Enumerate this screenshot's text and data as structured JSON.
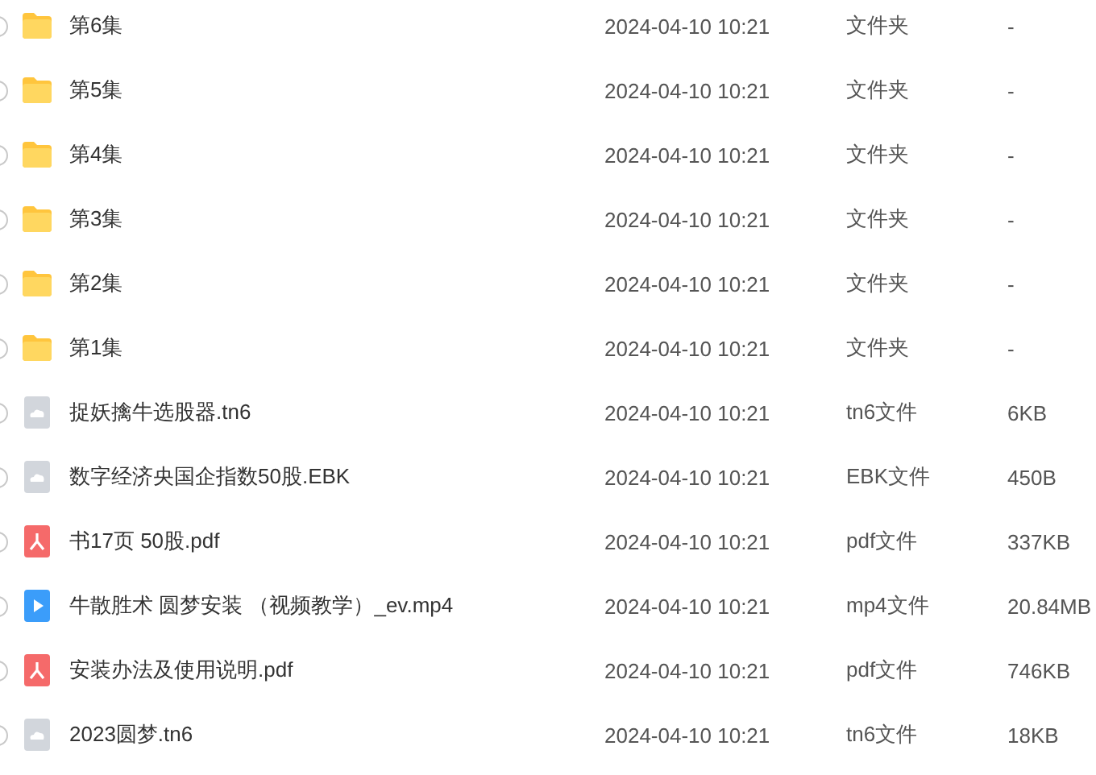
{
  "files": [
    {
      "kind": "folder",
      "checked": false,
      "name": "第6集",
      "modified": "2024-04-10 10:21",
      "type": "文件夹",
      "size": "-"
    },
    {
      "kind": "folder",
      "checked": false,
      "name": "第5集",
      "modified": "2024-04-10 10:21",
      "type": "文件夹",
      "size": "-"
    },
    {
      "kind": "folder",
      "checked": false,
      "name": "第4集",
      "modified": "2024-04-10 10:21",
      "type": "文件夹",
      "size": "-"
    },
    {
      "kind": "folder",
      "checked": false,
      "name": "第3集",
      "modified": "2024-04-10 10:21",
      "type": "文件夹",
      "size": "-"
    },
    {
      "kind": "folder",
      "checked": false,
      "name": "第2集",
      "modified": "2024-04-10 10:21",
      "type": "文件夹",
      "size": "-"
    },
    {
      "kind": "folder",
      "checked": false,
      "name": "第1集",
      "modified": "2024-04-10 10:21",
      "type": "文件夹",
      "size": "-"
    },
    {
      "kind": "cloud",
      "checked": false,
      "name": "捉妖擒牛选股器.tn6",
      "modified": "2024-04-10 10:21",
      "type": "tn6文件",
      "size": "6KB"
    },
    {
      "kind": "cloud",
      "checked": false,
      "name": "数字经济央国企指数50股.EBK",
      "modified": "2024-04-10 10:21",
      "type": "EBK文件",
      "size": "450B"
    },
    {
      "kind": "pdf",
      "checked": false,
      "name": "书17页 50股.pdf",
      "modified": "2024-04-10 10:21",
      "type": "pdf文件",
      "size": "337KB"
    },
    {
      "kind": "video",
      "checked": false,
      "name": "牛散胜术 圆梦安装 （视频教学）_ev.mp4",
      "modified": "2024-04-10 10:21",
      "type": "mp4文件",
      "size": "20.84MB"
    },
    {
      "kind": "pdf",
      "checked": false,
      "name": "安装办法及使用说明.pdf",
      "modified": "2024-04-10 10:21",
      "type": "pdf文件",
      "size": "746KB"
    },
    {
      "kind": "cloud",
      "checked": false,
      "name": "2023圆梦.tn6",
      "modified": "2024-04-10 10:21",
      "type": "tn6文件",
      "size": "18KB"
    }
  ]
}
